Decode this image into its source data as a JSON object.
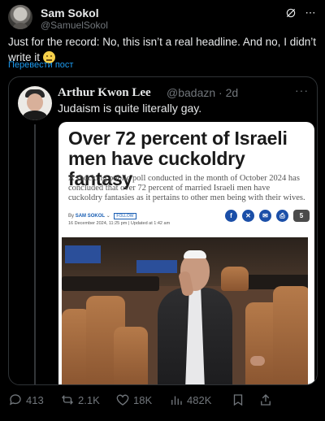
{
  "author": {
    "name": "Sam Sokol",
    "handle": "@SamuelSokol"
  },
  "top_icons": [
    "grok-icon",
    "more-icon"
  ],
  "post": {
    "text": "Just for the record: No, this isn’t a real headline. And no, I didn’t write it",
    "translate_label": "Перевести пост"
  },
  "quote": {
    "name": "Arthur Kwon Lee",
    "handle_time": "@badazn · 2d",
    "text": "Judaism is quite literally gay.",
    "article": {
      "headline": "Over 72 percent of Israeli men have cuckoldry fantasy",
      "subheadline": "A shocking public poll conducted in the month of October 2024 has concluded that over 72 percent of married Israeli men have cuckoldry fantasies as it pertains to other men being with their wives.",
      "by_prefix": "By",
      "author": "SAM SOKOL",
      "follow_label": "FOLLOW",
      "date": "16 December 2024, 11:25 pm  |  Updated at 1:42 am",
      "share_count": "5"
    }
  },
  "actions": {
    "replies": "413",
    "reposts": "2.1K",
    "likes": "18K",
    "views": "482K"
  },
  "colors": {
    "background": "#000000",
    "link": "#1d9bf0",
    "muted": "#71767b",
    "share_blue": "#1b4fa8"
  }
}
